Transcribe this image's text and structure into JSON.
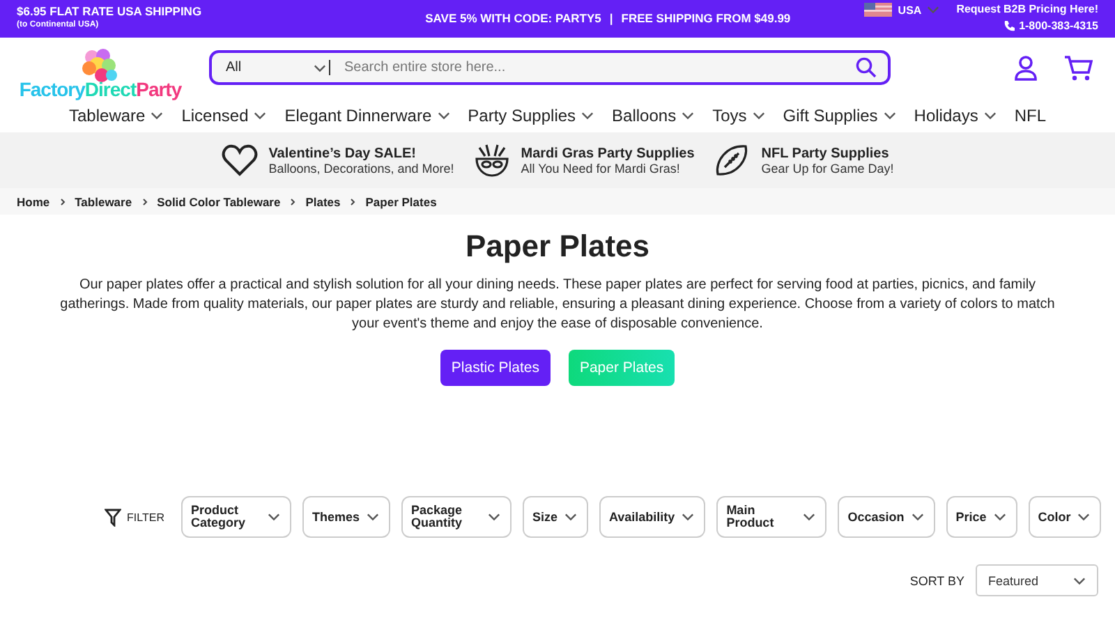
{
  "top_bar": {
    "shipping": "$6.95 FLAT RATE USA SHIPPING",
    "shipping_note": "(to Continental USA)",
    "promo": "SAVE 5% WITH CODE: PARTY5",
    "separator": "|",
    "free_shipping": "FREE SHIPPING FROM $49.99",
    "country": "USA",
    "b2b": "Request B2B Pricing Here!",
    "phone": "1-800-383-4315"
  },
  "logo": [
    {
      "text": "Factory",
      "color": "#27c3ea"
    },
    {
      "text": "Direct",
      "color": "#1fd9b5"
    },
    {
      "text": "Party",
      "color": "#f2397f"
    }
  ],
  "search": {
    "category": "All",
    "placeholder": "Search entire store here..."
  },
  "nav": [
    {
      "label": "Tableware",
      "dropdown": true
    },
    {
      "label": "Licensed",
      "dropdown": true
    },
    {
      "label": "Elegant Dinnerware",
      "dropdown": true
    },
    {
      "label": "Party Supplies",
      "dropdown": true
    },
    {
      "label": "Balloons",
      "dropdown": true
    },
    {
      "label": "Toys",
      "dropdown": true
    },
    {
      "label": "Gift Supplies",
      "dropdown": true
    },
    {
      "label": "Holidays",
      "dropdown": true
    },
    {
      "label": "NFL",
      "dropdown": false
    }
  ],
  "promos": [
    {
      "kind": "heart",
      "title": "Valentine’s Day SALE!",
      "subtitle": "Balloons, Decorations, and More!"
    },
    {
      "kind": "mask",
      "title": "Mardi Gras Party Supplies",
      "subtitle": "All You Need for Mardi Gras!"
    },
    {
      "kind": "football",
      "title": "NFL Party Supplies",
      "subtitle": "Gear Up for Game Day!"
    }
  ],
  "breadcrumbs": [
    "Home",
    "Tableware",
    "Solid Color Tableware",
    "Plates",
    "Paper Plates"
  ],
  "page": {
    "title": "Paper Plates",
    "description": "Our paper plates offer a practical and stylish solution for all your dining needs. These paper plates are perfect for serving food at parties, picnics, and family gatherings. Made from quality materials, our paper plates are sturdy and reliable, ensuring a pleasant dining experience. Choose from a variety of colors to match your event's theme and enjoy the ease of disposable convenience."
  },
  "categories": [
    {
      "label": "Plastic Plates",
      "selected": false
    },
    {
      "label": "Paper Plates",
      "selected": true
    }
  ],
  "filter_label": "FILTER",
  "filters": [
    "Product Category",
    "Themes",
    "Package Quantity",
    "Size",
    "Availability",
    "Main Product",
    "Occasion",
    "Price",
    "Color"
  ],
  "sort": {
    "label": "SORT BY",
    "value": "Featured"
  }
}
